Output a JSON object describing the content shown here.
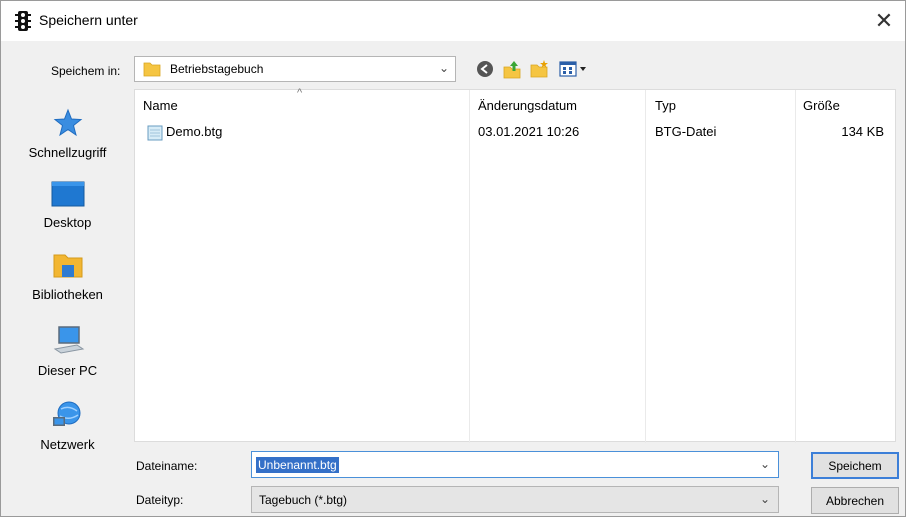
{
  "window": {
    "title": "Speichern unter",
    "close_glyph": "✕"
  },
  "toolbar": {
    "location_label": "Speichem in:",
    "location_value": "Betriebstagebuch",
    "icons": [
      "back-icon",
      "up-folder-icon",
      "new-folder-icon",
      "view-menu-icon"
    ]
  },
  "places": [
    {
      "label": "Schnellzugriff",
      "icon": "star-icon"
    },
    {
      "label": "Desktop",
      "icon": "desktop-icon"
    },
    {
      "label": "Bibliotheken",
      "icon": "library-icon"
    },
    {
      "label": "Dieser PC",
      "icon": "computer-icon"
    },
    {
      "label": "Netzwerk",
      "icon": "network-icon"
    }
  ],
  "filelist": {
    "columns": [
      "Name",
      "Änderungsdatum",
      "Typ",
      "Größe"
    ],
    "sort_glyph": "^",
    "rows": [
      {
        "name": "Demo.btg",
        "date": "03.01.2021 10:26",
        "type": "BTG-Datei",
        "size": "134 KB"
      }
    ]
  },
  "form": {
    "filename_label": "Dateiname:",
    "filename_value": "Unbenannt.btg",
    "filetype_label": "Dateityp:",
    "filetype_value": "Tagebuch (*.btg)"
  },
  "buttons": {
    "save": "Speichem",
    "cancel": "Abbrechen"
  },
  "colors": {
    "accent": "#3c7fd8",
    "selection": "#3470c8",
    "folder": "#f5c542"
  }
}
